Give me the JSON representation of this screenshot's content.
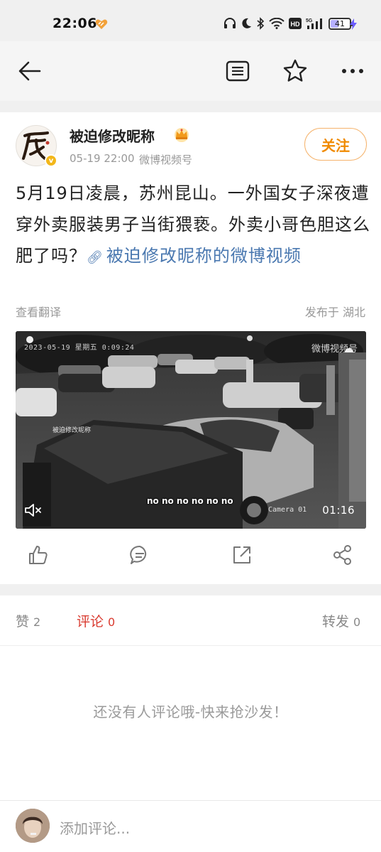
{
  "status_bar": {
    "time": "22:06",
    "battery": "41",
    "battery_level": 0.41,
    "icons": [
      "heart-icon",
      "headphones-icon",
      "moon-icon",
      "bluetooth-icon",
      "wifi-icon",
      "hd-icon",
      "5g-signal-icon",
      "battery-icon",
      "charging-icon"
    ]
  },
  "nav": {
    "icons": [
      "back-arrow-icon",
      "document-icon",
      "star-icon",
      "more-icon"
    ]
  },
  "post": {
    "username": "被迫修改昵称",
    "time": "05-19 22:00",
    "source": "微博视频号",
    "follow_label": "关注",
    "text": "5月19日凌晨，苏州昆山。一外国女子深夜遭穿外卖服装男子当街猥亵。外卖小哥色胆这么肥了吗？",
    "link_text": "被迫修改昵称的微博视频",
    "translate_label": "查看翻译",
    "location": "发布于 湖北"
  },
  "video": {
    "timestamp": "2023-05-19 星期五 0:09:24",
    "watermark": "微博视频号",
    "overlay_username": "被迫修改昵称",
    "subtitle": "no no no no no no",
    "camera_label": "Camera 01",
    "duration": "01:16"
  },
  "actions": [
    "like-icon",
    "comment-icon",
    "repost-icon",
    "share-icon"
  ],
  "tabs": {
    "likes": {
      "label": "赞",
      "count": "2"
    },
    "comments": {
      "label": "评论",
      "count": "0"
    },
    "reposts": {
      "label": "转发",
      "count": "0"
    }
  },
  "empty_message": "还没有人评论哦-快来抢沙发！",
  "comment_bar": {
    "placeholder": "添加评论..."
  },
  "colors": {
    "accent_orange": "#f08a00",
    "link_blue": "#4a78b0",
    "active_red": "#d93a2f"
  }
}
